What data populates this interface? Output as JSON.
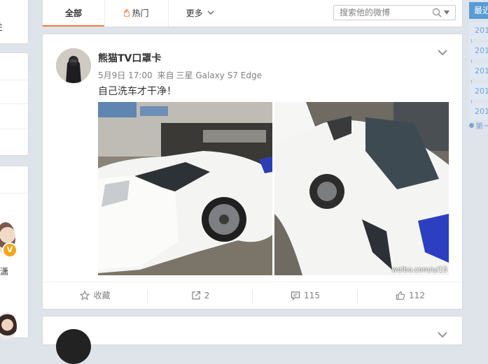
{
  "left_column": {
    "card1_text": "Ė",
    "profile_name_fragment": "潇"
  },
  "tabs": [
    {
      "label": "全部"
    },
    {
      "label": "热门"
    },
    {
      "label": "更多"
    }
  ],
  "search": {
    "placeholder": "搜索他的微博"
  },
  "post": {
    "author": "熊猫TV口罩卡",
    "date": "5月9日 17:00",
    "source_prefix": "来自",
    "source": "三星 Galaxy S7 Edge",
    "text": "自己洗车才干净！",
    "watermark": "weibo.com/u/15",
    "actions": {
      "favorite": "收藏",
      "repost_count": "2",
      "comment_count": "115",
      "like_count": "112"
    }
  },
  "right_column": {
    "header": "最近",
    "years": [
      "201",
      "201",
      "201",
      "201",
      "201"
    ],
    "last": "第一"
  },
  "colors": {
    "accent": "#fa7d3c",
    "background": "#dfe4ea",
    "sidebar_blue": "#5b9bd5",
    "vip_badge": "#f7a51b"
  },
  "icons": [
    "flame-icon",
    "chevron-down-icon",
    "search-icon",
    "star-icon",
    "repost-icon",
    "comment-icon",
    "thumbs-up-icon"
  ]
}
